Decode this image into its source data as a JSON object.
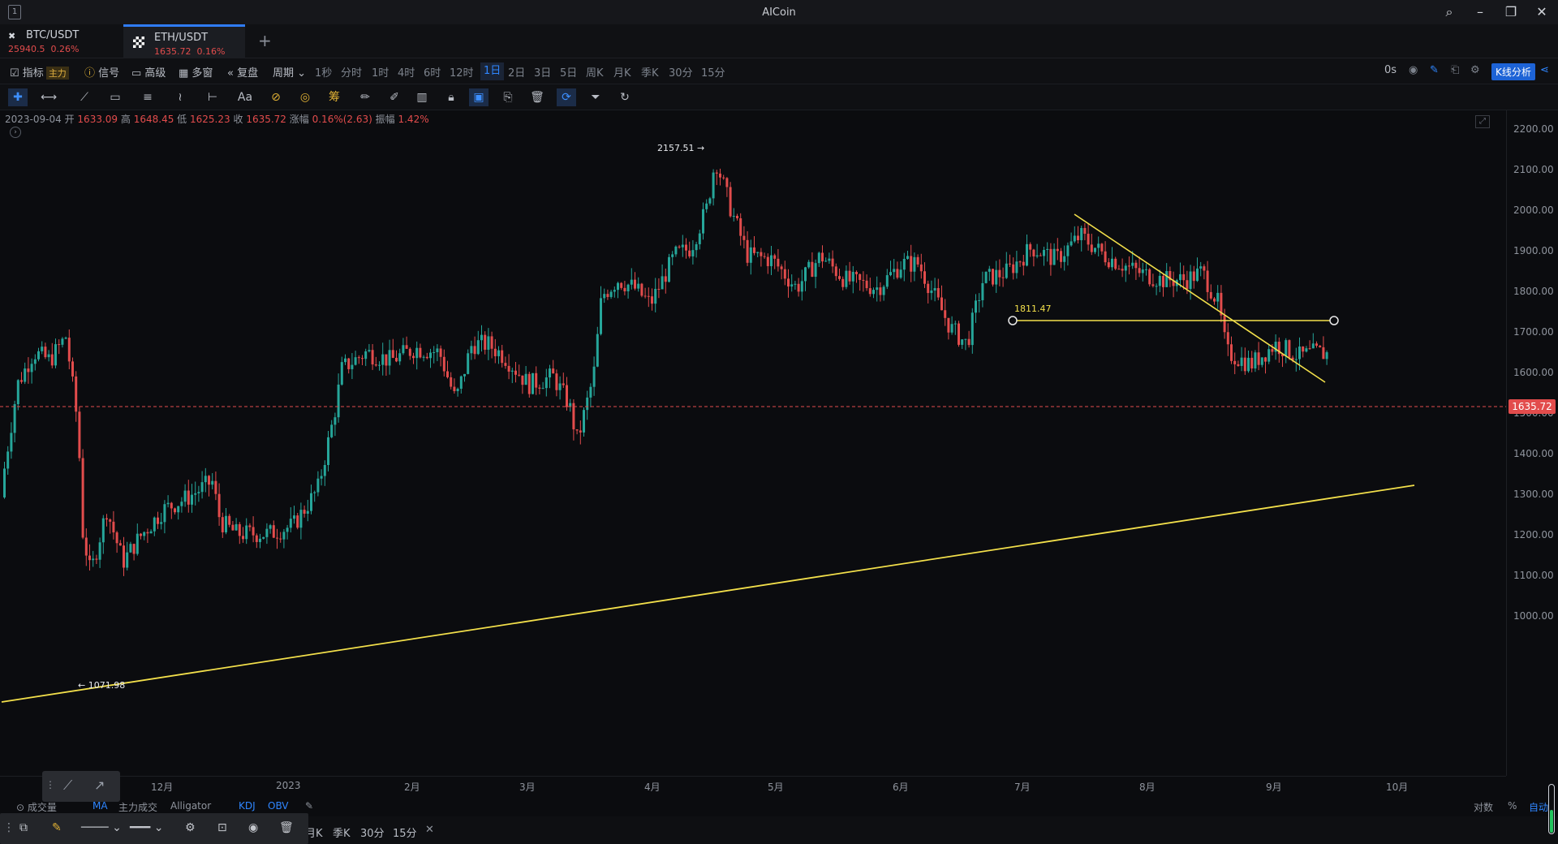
{
  "window": {
    "title": "AICoin"
  },
  "tabs": [
    {
      "symbol": "BTC/USDT",
      "price": "25940.5",
      "change": "0.26%"
    },
    {
      "symbol": "ETH/USDT",
      "price": "1635.72",
      "change": "0.16%"
    }
  ],
  "toolbar": {
    "indicator": "指标",
    "indicator_badge": "主力",
    "signal": "信号",
    "advanced": "高级",
    "multi_window": "多窗",
    "replay": "复盘",
    "period": "周期",
    "intervals": [
      "1秒",
      "分时",
      "1时",
      "4时",
      "6时",
      "12时",
      "1日",
      "2日",
      "3日",
      "5日",
      "周K",
      "月K",
      "季K",
      "30分",
      "15分"
    ],
    "active_interval": "1日",
    "countdown": "0s",
    "k_analysis": "K线分析"
  },
  "ohlc": {
    "date": "2023-09-04",
    "open_label": "开",
    "open": "1633.09",
    "high_label": "高",
    "high": "1648.45",
    "low_label": "低",
    "low": "1625.23",
    "close_label": "收",
    "close": "1635.72",
    "change_label": "涨幅",
    "change": "0.16%(2.63)",
    "amp_label": "振幅",
    "amp": "1.42%"
  },
  "y_axis": {
    "ticks": [
      "2200.00",
      "2100.00",
      "2000.00",
      "1900.00",
      "1800.00",
      "1700.00",
      "1600.00",
      "1500.00",
      "1400.00",
      "1300.00",
      "1200.00",
      "1100.00",
      "1000.00"
    ],
    "current_price": "1635.72"
  },
  "x_axis": {
    "ticks": [
      "12月",
      "2023",
      "2月",
      "3月",
      "4月",
      "5月",
      "6月",
      "7月",
      "8月",
      "9月",
      "10月"
    ]
  },
  "annotations": {
    "high": "2157.51",
    "low": "1071.98",
    "hline": "1811.47"
  },
  "bottom_tabs": {
    "items": [
      "成交量",
      "MA",
      "主力成交",
      "Alligator",
      "KDJ",
      "OBV"
    ],
    "right": [
      "对数",
      "%",
      "自动"
    ]
  },
  "bottom_intervals": [
    "月K",
    "季K",
    "30分",
    "15分"
  ],
  "colors": {
    "up": "#26a69a",
    "down": "#e24c4c",
    "trendline": "#f3e04b",
    "accent": "#2f7cf6"
  }
}
